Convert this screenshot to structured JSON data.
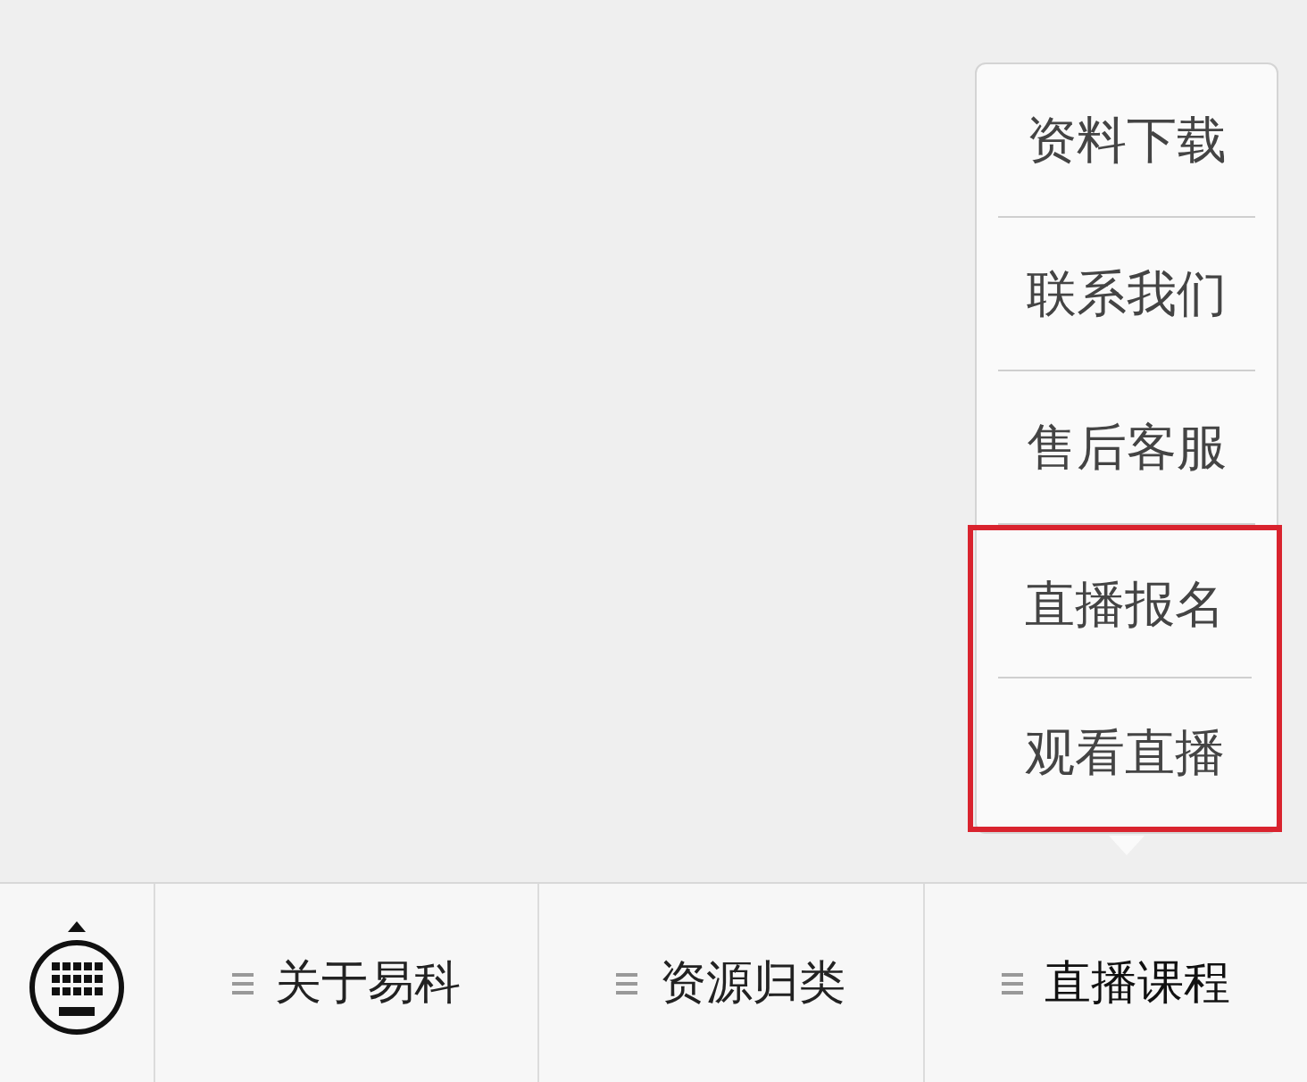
{
  "popup_menu": {
    "items": [
      {
        "label": "资料下载",
        "highlighted": false
      },
      {
        "label": "联系我们",
        "highlighted": false
      },
      {
        "label": "售后客服",
        "highlighted": false
      },
      {
        "label": "直播报名",
        "highlighted": true
      },
      {
        "label": "观看直播",
        "highlighted": true
      }
    ]
  },
  "menu_bar": {
    "items": [
      {
        "label": "关于易科",
        "selected": false
      },
      {
        "label": "资源归类",
        "selected": false
      },
      {
        "label": "直播课程",
        "selected": true
      }
    ]
  }
}
